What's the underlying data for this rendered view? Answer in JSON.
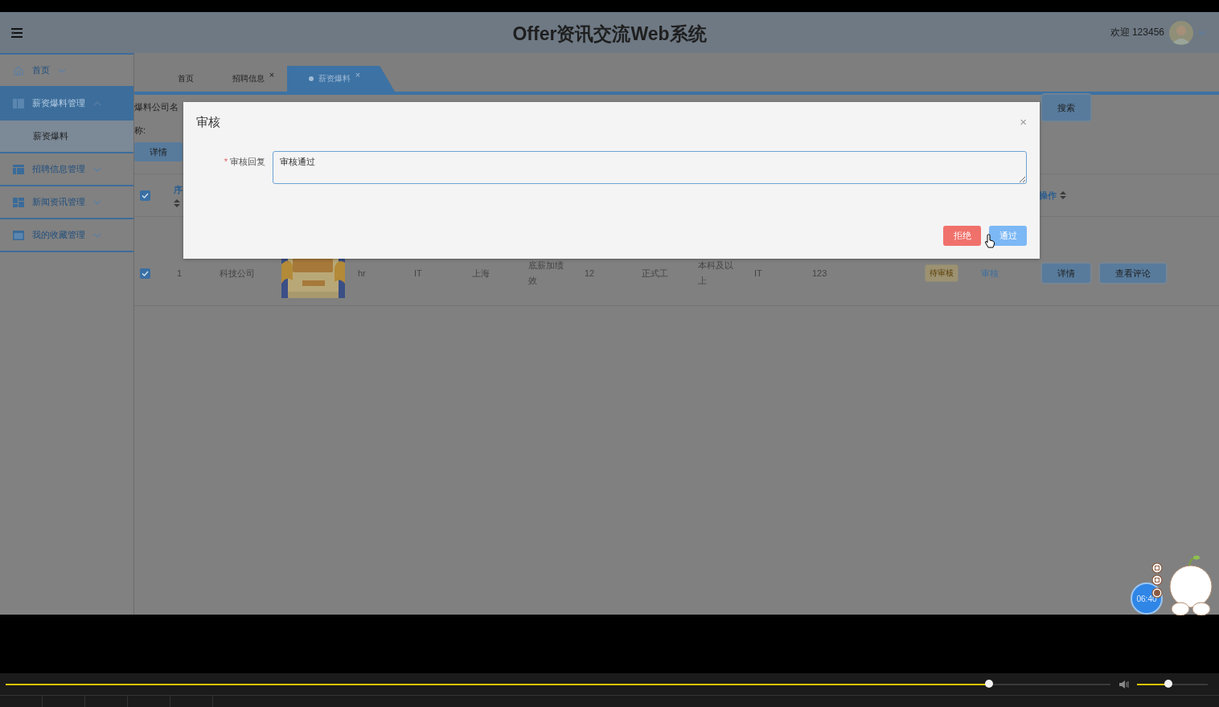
{
  "header": {
    "title": "Offer资讯交流Web系统",
    "welcome": "欢迎 123456"
  },
  "sidebar": {
    "items": [
      {
        "label": "首页",
        "expanded": false,
        "selected": false
      },
      {
        "label": "薪资爆料管理",
        "expanded": true,
        "selected": true,
        "children": [
          {
            "label": "薪资爆料",
            "selected": false
          }
        ]
      },
      {
        "label": "招聘信息管理",
        "expanded": false,
        "selected": false
      },
      {
        "label": "新闻资讯管理",
        "expanded": false,
        "selected": false
      },
      {
        "label": "我的收藏管理",
        "expanded": false,
        "selected": false
      }
    ]
  },
  "tabs": [
    {
      "label": "首页",
      "selected": false
    },
    {
      "label": "招聘信息",
      "close": "×",
      "selected": false
    },
    {
      "label": "薪资爆料",
      "close": "×",
      "selected": true
    }
  ],
  "filters": {
    "company_label": "爆料公司名",
    "label_2": "称:",
    "detail_button": "详情",
    "search_button": "搜索"
  },
  "table": {
    "header_checked": true,
    "columns": [
      {
        "label": "序",
        "sortable": true
      },
      {
        "label": "操作",
        "sortable": true
      }
    ],
    "rows": [
      {
        "checked": true,
        "cells": [
          "1",
          "科技公司",
          "hr",
          "IT",
          "上海",
          "底薪加绩效",
          "12",
          "正式工",
          "本科及以上",
          "IT",
          "123"
        ],
        "image": {
          "kind": "picture"
        },
        "status": "待审核",
        "review_link": "审核",
        "buttons": [
          "详情",
          "查看评论"
        ]
      }
    ]
  },
  "dialog": {
    "title": "审核",
    "close": "×",
    "required_mark": "*",
    "field_label": "审核回复",
    "value": "审核通过",
    "buttons": [
      {
        "label": "拒绝",
        "kind": "danger"
      },
      {
        "label": "通过",
        "kind": "primary"
      }
    ]
  },
  "player": {
    "progress": {
      "level": 0.89
    },
    "volume": {
      "level": 0.44
    },
    "clock": "06:40"
  }
}
